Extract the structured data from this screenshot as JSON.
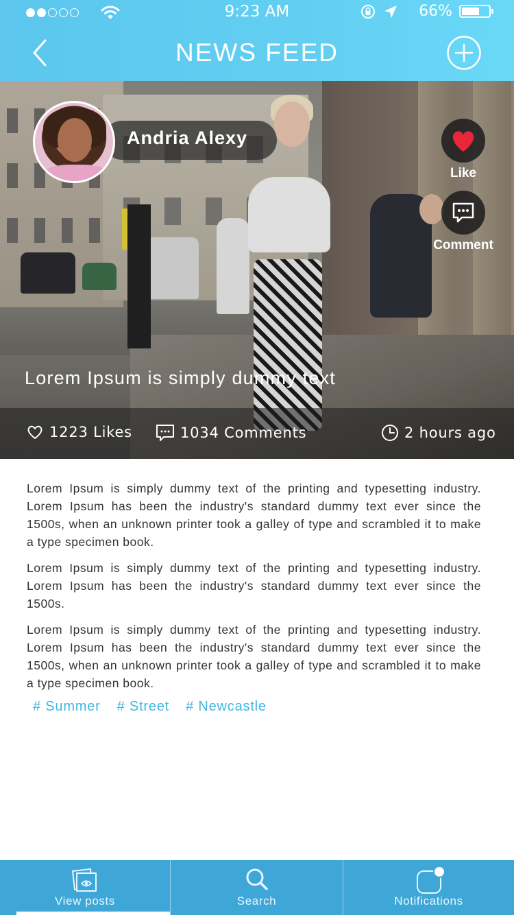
{
  "status_bar": {
    "time": "9:23 AM",
    "battery": "66%",
    "battery_level": 0.66,
    "signal_dots_filled": 2,
    "signal_dots_total": 5
  },
  "header": {
    "title": "NEWS FEED",
    "back_icon": "chevron-left-icon",
    "add_icon": "plus-circle-icon"
  },
  "post": {
    "author": "Andria Alexy",
    "caption": "Lorem Ipsum is simply dummy text",
    "actions": {
      "like_label": "Like",
      "comment_label": "Comment"
    },
    "stats": {
      "likes": "1223 Likes",
      "comments": "1034 Comments",
      "time_ago": "2 hours ago"
    },
    "paragraphs": [
      "Lorem Ipsum is simply dummy text of the printing and typesetting industry. Lorem Ipsum has been the industry's standard dummy text ever since the 1500s, when an unknown printer took a galley of type and scrambled it to make a type specimen book.",
      "Lorem Ipsum is simply dummy text of the printing and typesetting industry. Lorem Ipsum has been the industry's standard dummy text ever since the 1500s.",
      "Lorem Ipsum is simply dummy text of the printing and typesetting industry. Lorem Ipsum has been the industry's standard dummy text ever since the 1500s, when an unknown printer took a galley of type and scrambled it to make a type specimen book."
    ],
    "tags": [
      "# Summer",
      "# Street",
      "# Newcastle"
    ]
  },
  "tabbar": {
    "tabs": [
      {
        "label": "View posts",
        "icon": "view-posts-icon",
        "active": true
      },
      {
        "label": "Search",
        "icon": "search-icon",
        "active": false
      },
      {
        "label": "Notifications",
        "icon": "notification-icon",
        "active": false
      }
    ]
  },
  "colors": {
    "header": "#62cff2",
    "tabbar": "#3ea7d8",
    "tag": "#3fb6e2",
    "like_heart": "#e8283a"
  }
}
